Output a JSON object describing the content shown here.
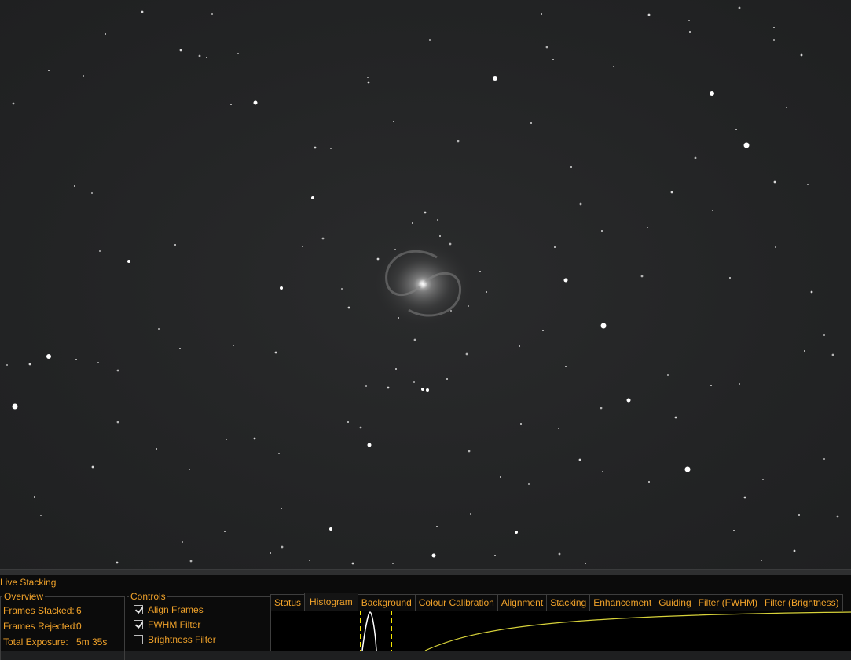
{
  "panel": {
    "title": "Live Stacking"
  },
  "overview": {
    "title": "Overview",
    "rows": [
      {
        "label": "Frames Stacked:",
        "value": "6"
      },
      {
        "label": "Frames Rejected:",
        "value": "0"
      },
      {
        "label": "Total Exposure:",
        "value": "5m 35s"
      }
    ]
  },
  "controls": {
    "title": "Controls",
    "items": [
      {
        "label": "Align Frames",
        "checked": true
      },
      {
        "label": "FWHM Filter",
        "checked": true
      },
      {
        "label": "Brightness Filter",
        "checked": false
      }
    ]
  },
  "tabs": [
    {
      "label": "Status",
      "active": false
    },
    {
      "label": "Histogram",
      "active": true
    },
    {
      "label": "Background",
      "active": false
    },
    {
      "label": "Colour Calibration",
      "active": false
    },
    {
      "label": "Alignment",
      "active": false
    },
    {
      "label": "Stacking",
      "active": false
    },
    {
      "label": "Enhancement",
      "active": false
    },
    {
      "label": "Guiding",
      "active": false
    },
    {
      "label": "Filter (FWHM)",
      "active": false
    },
    {
      "label": "Filter (Brightness)",
      "active": false
    }
  ],
  "colors": {
    "accent": "#f0a22a",
    "histogram_marker": "#f5e600",
    "histogram_curve": "#ffffff",
    "stretch_curve": "#d7d23a"
  }
}
